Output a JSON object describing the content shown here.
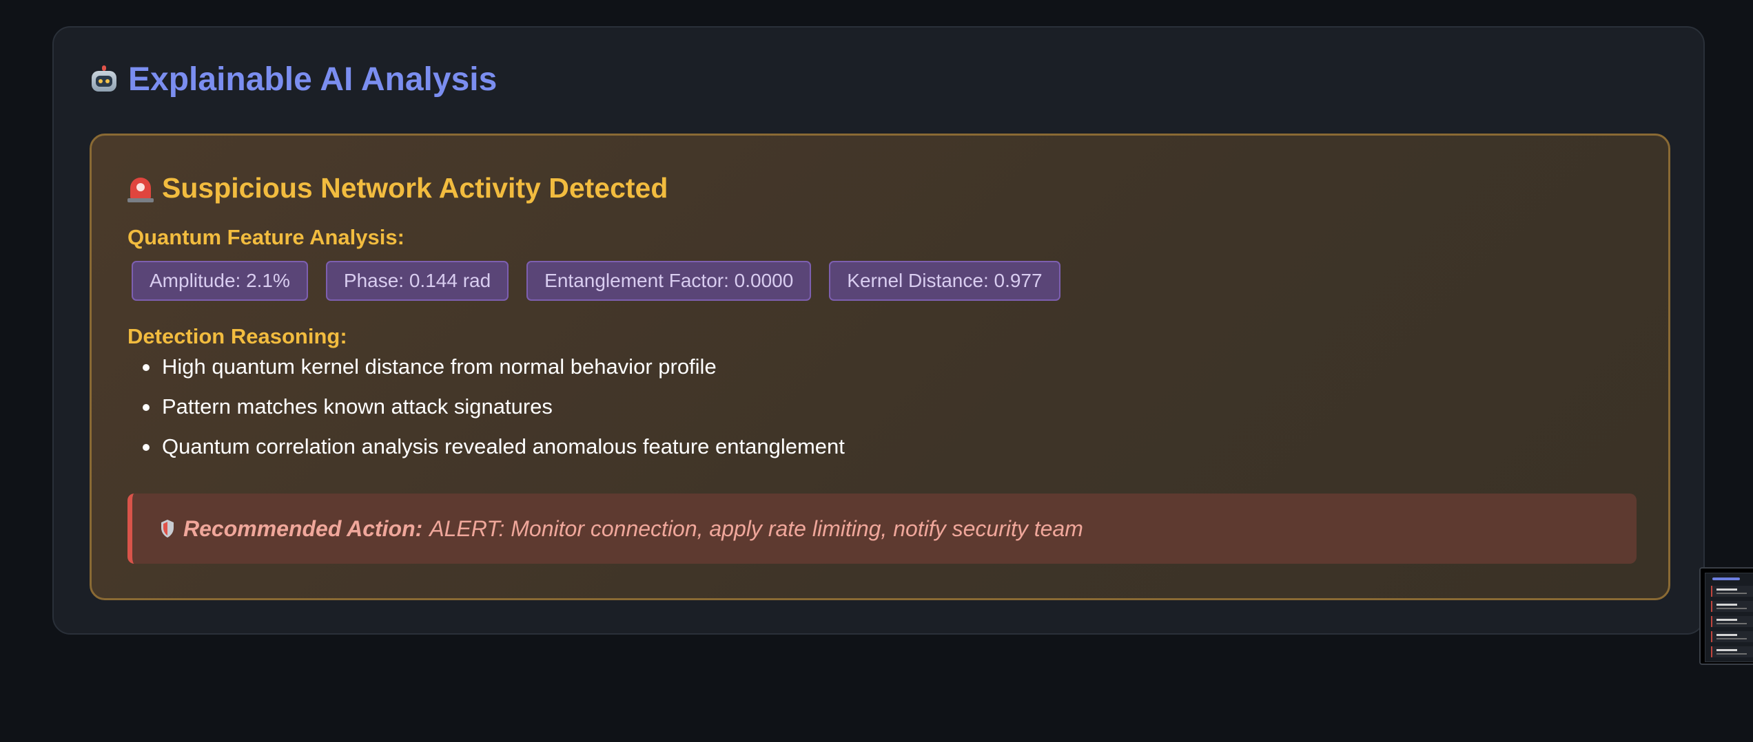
{
  "panel": {
    "title": "Explainable AI Analysis",
    "title_icon": "robot-icon"
  },
  "alert": {
    "title": "Suspicious Network Activity Detected",
    "title_icon": "siren-icon",
    "features_label": "Quantum Feature Analysis:",
    "features": [
      "Amplitude: 2.1%",
      "Phase: 0.144 rad",
      "Entanglement Factor: 0.0000",
      "Kernel Distance: 0.977"
    ],
    "reasoning_label": "Detection Reasoning:",
    "reasons": [
      "High quantum kernel distance from normal behavior profile",
      "Pattern matches known attack signatures",
      "Quantum correlation analysis revealed anomalous feature entanglement"
    ],
    "action_icon": "shield-icon",
    "action_label": "Recommended Action:",
    "action_text": "ALERT: Monitor connection, apply rate limiting, notify security team"
  },
  "colors": {
    "background": "#0f1217",
    "panel": "#1b1f26",
    "title_accent": "#7b8ef0",
    "alert_accent": "#f2bc3f",
    "chip_bg": "#5a4577",
    "action_border": "#d9544a",
    "action_text": "#f0a79b"
  }
}
